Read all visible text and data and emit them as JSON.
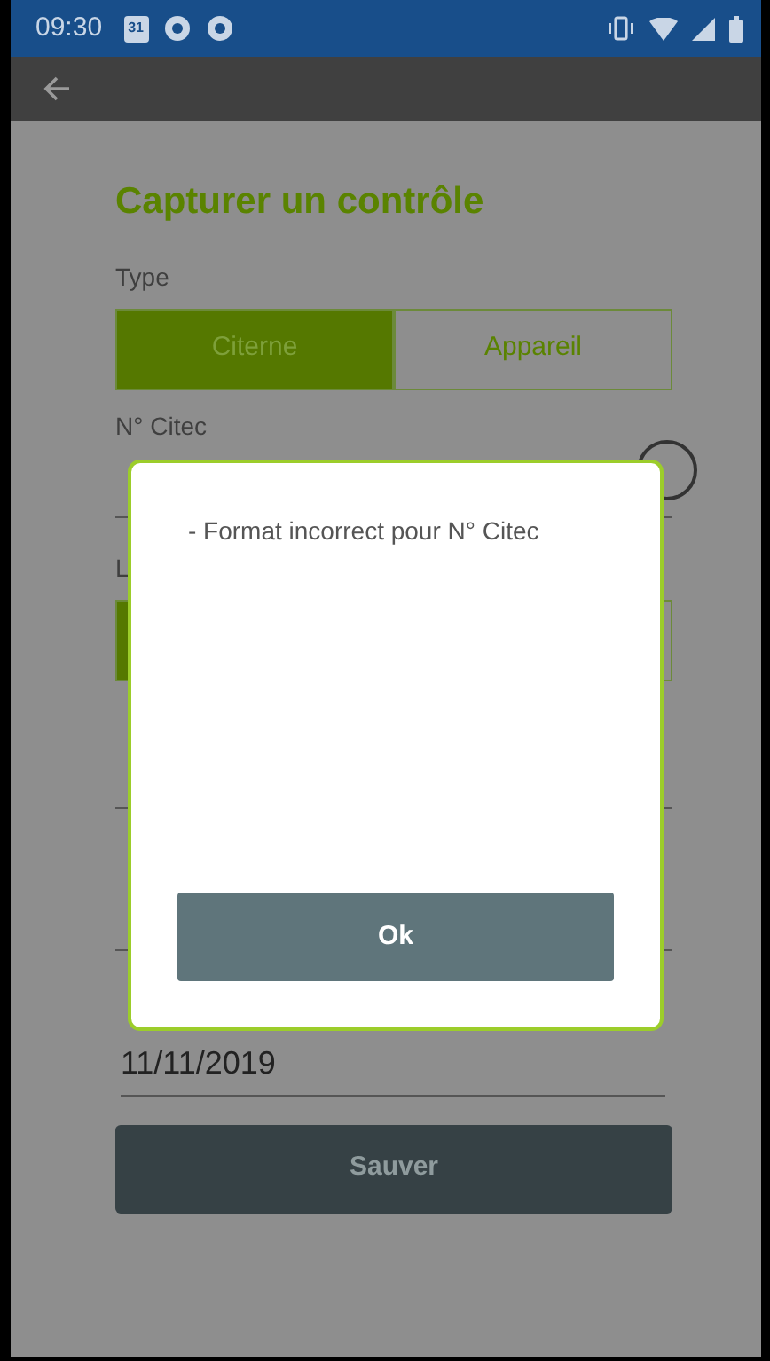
{
  "status_bar": {
    "time": "09:30",
    "calendar_day": "31"
  },
  "form": {
    "title": "Capturer un contrôle",
    "type_label": "Type",
    "type_options": [
      {
        "label": "Citerne",
        "selected": true
      },
      {
        "label": "Appareil",
        "selected": false
      }
    ],
    "citec_label": "N° Citec",
    "partly_hidden_label": "L",
    "second_toggle": [
      {
        "selected": true
      },
      {
        "selected": false
      }
    ],
    "date_value": "11/11/2019",
    "save_button": "Sauver"
  },
  "dialog": {
    "message": "- Format incorrect pour N° Citec",
    "ok_button": "Ok"
  }
}
